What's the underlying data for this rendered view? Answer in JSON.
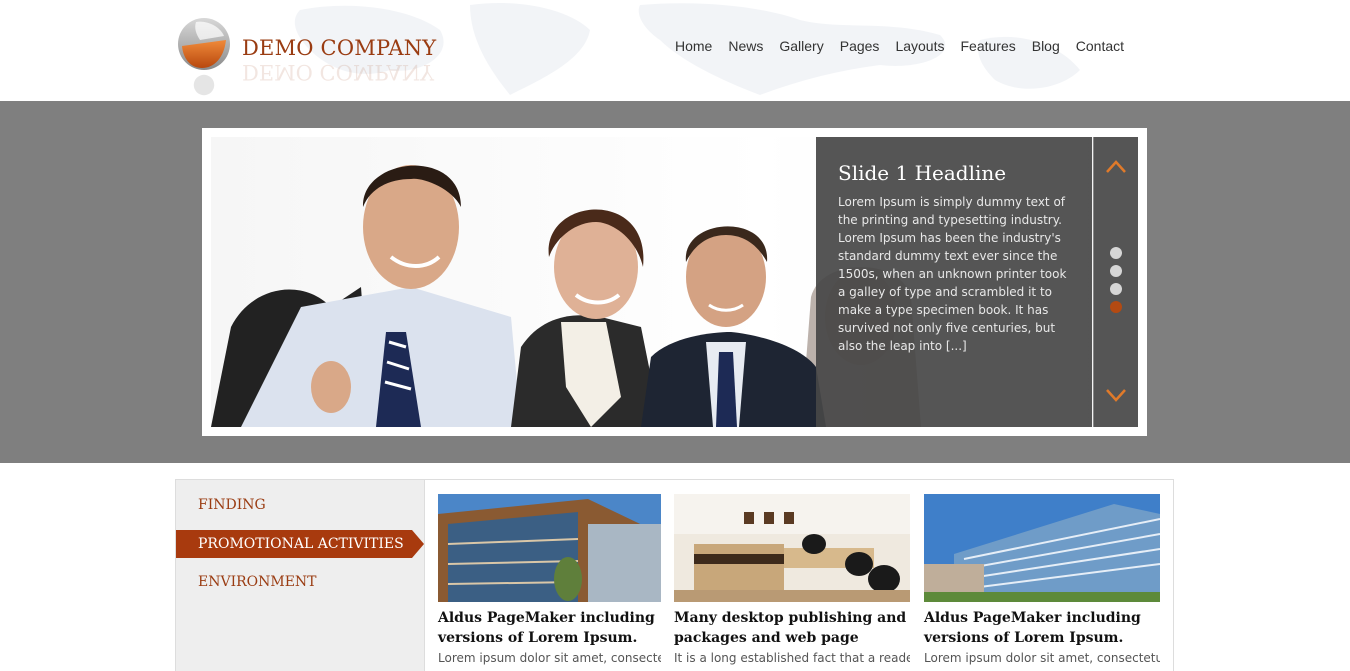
{
  "brand": {
    "name": "DEMO COMPANY",
    "accent": "#9a3c12"
  },
  "nav": {
    "items": [
      {
        "label": "Home"
      },
      {
        "label": "News"
      },
      {
        "label": "Gallery"
      },
      {
        "label": "Pages"
      },
      {
        "label": "Layouts"
      },
      {
        "label": "Features"
      },
      {
        "label": "Blog"
      },
      {
        "label": "Contact"
      }
    ]
  },
  "slider": {
    "headline": "Slide 1 Headline",
    "body": "Lorem Ipsum is simply dummy text of the printing and typesetting industry. Lorem Ipsum has been the industry's standard dummy text ever since the 1500s, when an unknown printer took a galley of type and scrambled it to make a type specimen book. It has survived not only five centuries, but also the leap into [...]",
    "prev_icon": "chevron-up-icon",
    "next_icon": "chevron-down-icon",
    "slide_count": 4,
    "active_slide": 4
  },
  "sidebar": {
    "items": [
      {
        "label": "FINDING"
      },
      {
        "label": "PROMOTIONAL ACTIVITIES",
        "active": true
      },
      {
        "label": "ENVIRONMENT"
      }
    ]
  },
  "cards": [
    {
      "title_line1": "Aldus PageMaker including",
      "title_line2": "versions of Lorem Ipsum.",
      "excerpt": "Lorem ipsum dolor sit amet, consectetur"
    },
    {
      "title_line1": "Many desktop publishing and",
      "title_line2": "packages and web page",
      "excerpt": "It is a long established fact that a reader will"
    },
    {
      "title_line1": "Aldus PageMaker including",
      "title_line2": "versions of Lorem Ipsum.",
      "excerpt": "Lorem ipsum dolor sit amet, consectetur"
    }
  ]
}
